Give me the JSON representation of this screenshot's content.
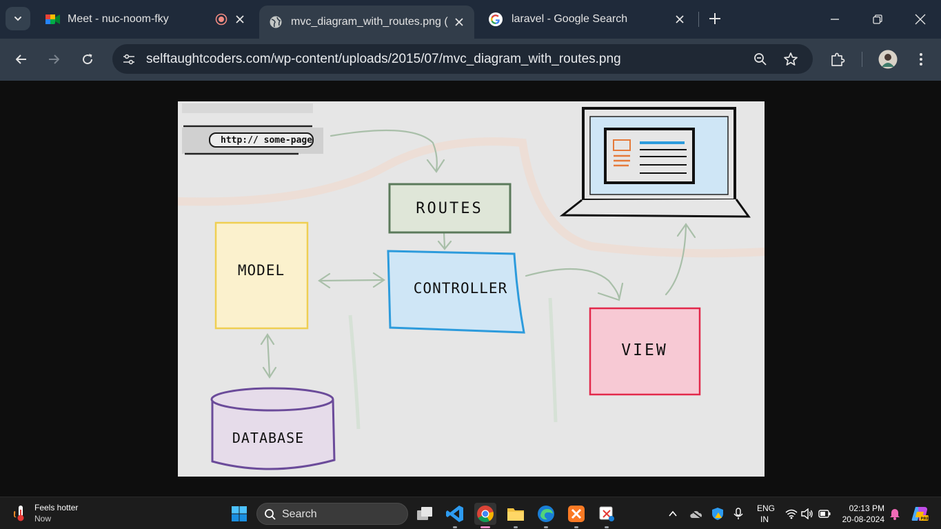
{
  "tabs": [
    {
      "title": "Meet - nuc-noom-fky",
      "icon": "google-meet-icon",
      "recording": true
    },
    {
      "title": "mvc_diagram_with_routes.png (",
      "icon": "globe-icon",
      "active": true
    },
    {
      "title": "laravel - Google Search",
      "icon": "google-g-icon"
    }
  ],
  "omnibox": {
    "url": "selftaughtcoders.com/wp-content/uploads/2015/07/mvc_diagram_with_routes.png"
  },
  "diagram": {
    "url_text": "http:// some-page",
    "routes": "ROUTES",
    "model": "MODEL",
    "controller": "CONTROLLER",
    "view": "VIEW",
    "database": "DATABASE",
    "colors": {
      "routes_fill": "#dfe6d8",
      "routes_stroke": "#5b7a5b",
      "model_fill": "#fbf1cd",
      "model_stroke": "#efcf52",
      "controller_fill": "#cfe6f6",
      "controller_stroke": "#2d9bdc",
      "view_fill": "#f7c9d4",
      "view_stroke": "#e2294b",
      "database_fill": "#e6dcea",
      "database_stroke": "#6b4b9a",
      "screen_fill": "#cfe6f6"
    }
  },
  "taskbar": {
    "weather_title": "Feels hotter",
    "weather_sub": "Now",
    "search_label": "Search",
    "lang_top": "ENG",
    "lang_bottom": "IN",
    "time": "02:13 PM",
    "date": "20-08-2024"
  }
}
